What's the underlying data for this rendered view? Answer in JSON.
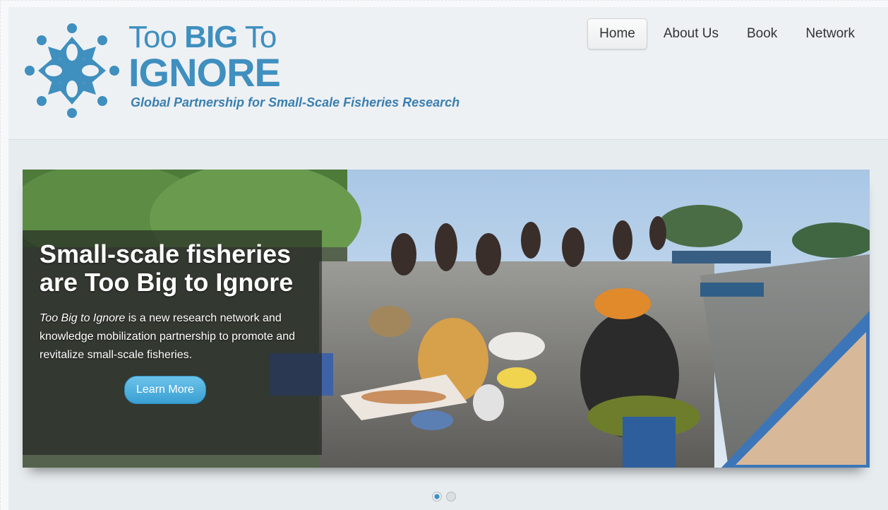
{
  "logo": {
    "line1_pre": "Too ",
    "line1_big": "BIG",
    "line1_post": " To",
    "line2": "IGNORE",
    "tagline": "Global Partnership for Small-Scale Fisheries Research",
    "color": "#3f8fbf"
  },
  "nav": {
    "items": [
      {
        "label": "Home",
        "active": true
      },
      {
        "label": "About Us",
        "active": false
      },
      {
        "label": "Book",
        "active": false
      },
      {
        "label": "Network",
        "active": false
      }
    ]
  },
  "slider": {
    "title": "Small-scale fisheries are Too Big to Ignore",
    "text_em": "Too Big to Ignore",
    "text_rest": " is a new research network and knowledge mobilization partnership to promote and revitalize small-scale fisheries.",
    "button_label": "Learn More",
    "dots": [
      {
        "active": true
      },
      {
        "active": false
      }
    ]
  },
  "colors": {
    "brand": "#3f8fbf",
    "button": "#3a9fd3"
  }
}
